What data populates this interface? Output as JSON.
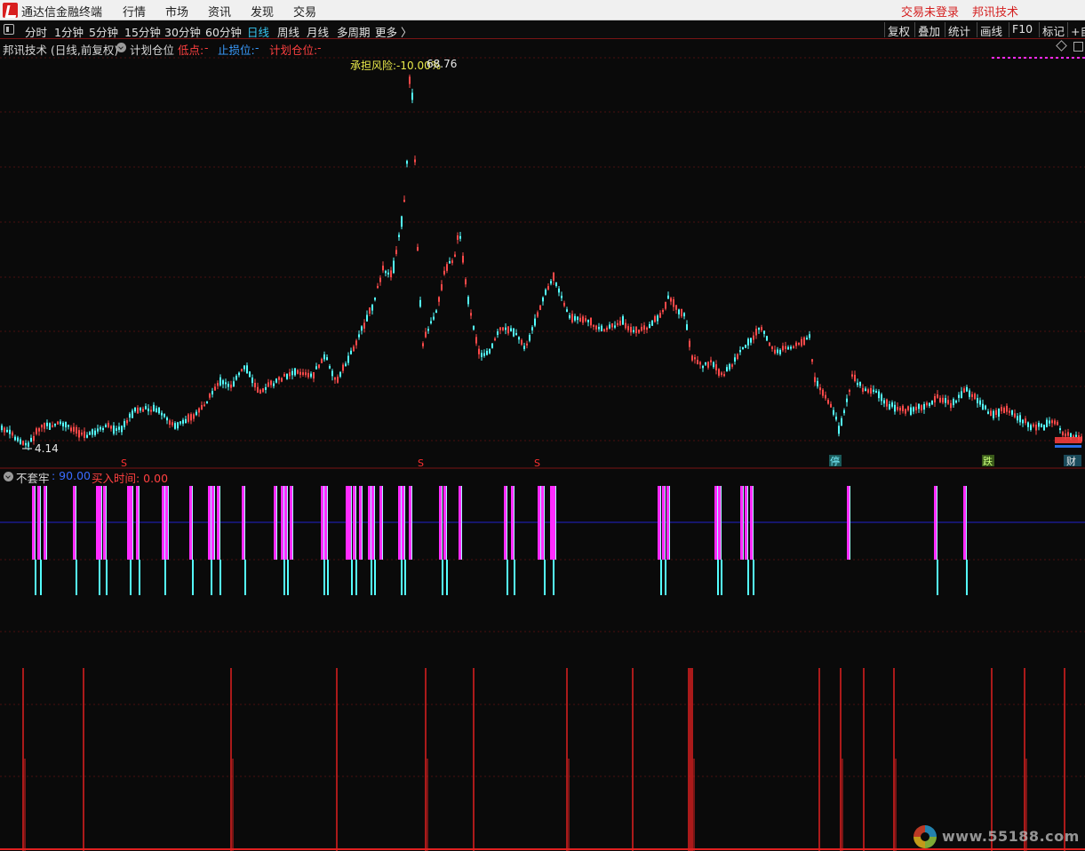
{
  "menubar": {
    "title": "通达信金融终端",
    "items": [
      "行情",
      "市场",
      "资讯",
      "发现",
      "交易"
    ],
    "right": [
      "交易未登录",
      "邦讯技术"
    ]
  },
  "toolbar": {
    "periods": [
      "分时",
      "1分钟",
      "5分钟",
      "15分钟",
      "30分钟",
      "60分钟",
      "日线",
      "周线",
      "月线",
      "多周期",
      "更多 〉"
    ],
    "active_period": "日线",
    "tools": [
      "复权",
      "叠加",
      "统计",
      "画线",
      "F10",
      "标记",
      "+自"
    ]
  },
  "header": {
    "title": "邦讯技术 (日线,前复权)",
    "indicator": "计划仓位",
    "low_label": "低点:",
    "low_value": "-",
    "stop_label": "止损位:",
    "stop_value": "-",
    "plan_label": "计划仓位:",
    "plan_value": "-"
  },
  "main_chart": {
    "risk_label": "承担风险:-10.00%",
    "high_label": "68.76",
    "low_label": "4.14",
    "s_markers": [
      "S",
      "S",
      "S"
    ],
    "event_markers": [
      "停",
      "跌",
      "财"
    ]
  },
  "indicator_panel": {
    "name": "不套牢",
    "param": ": 90.00",
    "buy_label": "买入时间: 0.00"
  },
  "colors": {
    "up": "#ff4a4a",
    "down": "#54ffff",
    "magenta": "#ff2bff",
    "pale_cyan": "#a9f7ff",
    "level_line": "#2222cc",
    "red_panel": "#e02020",
    "grid": "#4a1010"
  },
  "watermark": "www.55188.com"
}
